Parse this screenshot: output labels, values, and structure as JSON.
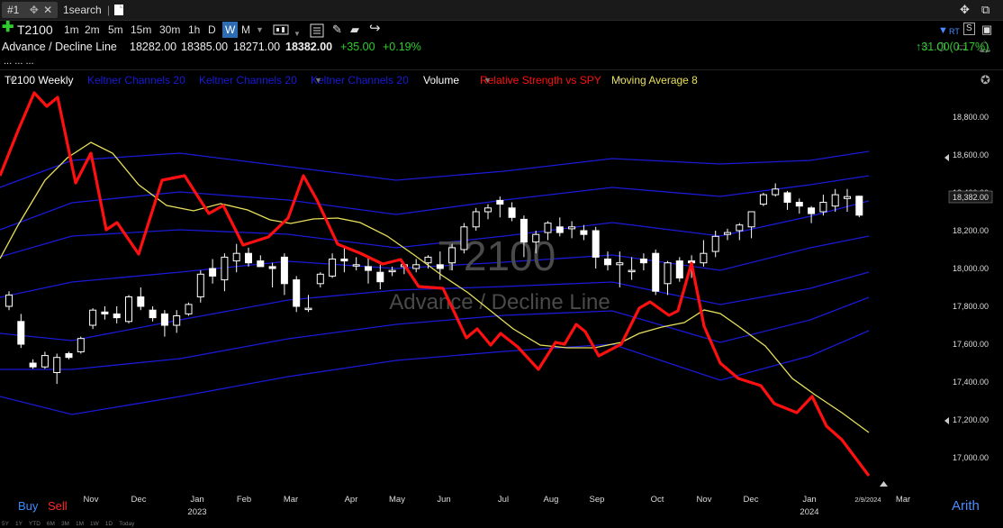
{
  "tabs": [
    {
      "label": "#1",
      "active": true
    },
    {
      "label": "1search",
      "active": false
    }
  ],
  "toolbar": {
    "symbol": "T2100",
    "timeframes": [
      "1m",
      "2m",
      "5m",
      "15m",
      "30m",
      "1h",
      "D",
      "W",
      "M"
    ],
    "active_timeframe": "W"
  },
  "quote": {
    "name": "Advance / Decline Line",
    "open": "18282.00",
    "high": "18385.00",
    "low": "18271.00",
    "close": "18382.00",
    "change": "+35.00",
    "change_pct": "+0.19%",
    "ellipsis": "... ...  ...",
    "right_change": "31.00(0.17%)"
  },
  "plots": {
    "main": "T2100 Weekly",
    "kc1": "Keltner Channels 20",
    "kc2": "Keltner Channels 20",
    "kc3": "Keltner Channels 20",
    "volume": "Volume",
    "rs": "Relative Strength vs SPY",
    "ma": "Moving Average 8"
  },
  "watermark": {
    "symbol": "T2100",
    "name": "Advance / Decline Line"
  },
  "colors": {
    "up": "#ffffff",
    "down": "#ffffff",
    "keltner": "#1a1ad6",
    "rs": "#ff1010",
    "ma": "#e8e05a",
    "change_up": "#2ecc2e"
  },
  "chart_data": {
    "type": "candlestick",
    "price_axis": [
      "18,800.00",
      "18,600.00",
      "18,400.00",
      "18,200.00",
      "18,000.00",
      "17,800.00",
      "17,600.00",
      "17,400.00",
      "17,200.00",
      "17,000.00"
    ],
    "current_price_label": "18,382.00",
    "x_labels": [
      "Nov",
      "Dec",
      "Jan",
      "Feb",
      "Mar",
      "Apr",
      "May",
      "Jun",
      "Jul",
      "Aug",
      "Sep",
      "Oct",
      "Nov",
      "Dec",
      "Jan",
      "2/9/2024",
      "Mar"
    ],
    "year_labels": [
      "2023",
      "2024"
    ],
    "candles": [
      [
        17800,
        17880,
        17780,
        17860
      ],
      [
        17720,
        17760,
        17580,
        17600
      ],
      [
        17500,
        17520,
        17470,
        17480
      ],
      [
        17480,
        17560,
        17470,
        17540
      ],
      [
        17450,
        17550,
        17390,
        17530
      ],
      [
        17550,
        17560,
        17520,
        17530
      ],
      [
        17560,
        17640,
        17550,
        17630
      ],
      [
        17700,
        17790,
        17680,
        17780
      ],
      [
        17770,
        17800,
        17730,
        17760
      ],
      [
        17760,
        17800,
        17710,
        17740
      ],
      [
        17720,
        17860,
        17710,
        17850
      ],
      [
        17850,
        17900,
        17780,
        17800
      ],
      [
        17780,
        17800,
        17720,
        17740
      ],
      [
        17760,
        17780,
        17640,
        17700
      ],
      [
        17700,
        17780,
        17660,
        17750
      ],
      [
        17760,
        17820,
        17750,
        17810
      ],
      [
        17850,
        17990,
        17820,
        17970
      ],
      [
        18000,
        18050,
        17920,
        17960
      ],
      [
        17940,
        18080,
        17880,
        18060
      ],
      [
        18040,
        18130,
        17980,
        18080
      ],
      [
        18080,
        18110,
        18010,
        18030
      ],
      [
        18040,
        18070,
        18010,
        18010
      ],
      [
        18010,
        18030,
        17900,
        18000
      ],
      [
        18060,
        18080,
        17860,
        17920
      ],
      [
        17940,
        17960,
        17770,
        17800
      ],
      [
        17790,
        17860,
        17770,
        17790
      ],
      [
        17920,
        17980,
        17900,
        17970
      ],
      [
        17960,
        18080,
        17950,
        18050
      ],
      [
        18050,
        18110,
        17980,
        18040
      ],
      [
        18020,
        18060,
        17990,
        18020
      ],
      [
        18010,
        18060,
        17920,
        17990
      ],
      [
        17980,
        18020,
        17890,
        17930
      ],
      [
        17990,
        18010,
        17960,
        17990
      ],
      [
        18010,
        18030,
        17970,
        18020
      ],
      [
        18000,
        18050,
        17980,
        18020
      ],
      [
        18030,
        18070,
        18000,
        18060
      ],
      [
        18020,
        18090,
        17940,
        18000
      ],
      [
        18030,
        18130,
        17990,
        18110
      ],
      [
        18100,
        18240,
        18080,
        18220
      ],
      [
        18220,
        18320,
        18200,
        18300
      ],
      [
        18300,
        18340,
        18260,
        18320
      ],
      [
        18360,
        18380,
        18270,
        18340
      ],
      [
        18320,
        18350,
        18250,
        18270
      ],
      [
        18260,
        18280,
        18060,
        18140
      ],
      [
        18140,
        18200,
        18080,
        18180
      ],
      [
        18190,
        18250,
        18150,
        18240
      ],
      [
        18220,
        18270,
        18170,
        18190
      ],
      [
        18210,
        18250,
        18160,
        18220
      ],
      [
        18200,
        18230,
        18150,
        18180
      ],
      [
        18200,
        18220,
        18000,
        18060
      ],
      [
        18050,
        18090,
        17990,
        18020
      ],
      [
        18020,
        18090,
        17900,
        18030
      ],
      [
        17990,
        18060,
        17940,
        17990
      ],
      [
        18050,
        18080,
        17990,
        18030
      ],
      [
        18080,
        18100,
        17860,
        17880
      ],
      [
        17920,
        18040,
        17860,
        18030
      ],
      [
        18040,
        18060,
        17930,
        17950
      ],
      [
        18040,
        18070,
        17950,
        18030
      ],
      [
        18030,
        18150,
        18010,
        18080
      ],
      [
        18090,
        18200,
        18060,
        18170
      ],
      [
        18180,
        18210,
        18150,
        18190
      ],
      [
        18200,
        18240,
        18150,
        18230
      ],
      [
        18220,
        18300,
        18160,
        18300
      ],
      [
        18340,
        18400,
        18330,
        18390
      ],
      [
        18390,
        18450,
        18380,
        18420
      ],
      [
        18400,
        18410,
        18310,
        18350
      ],
      [
        18350,
        18370,
        18290,
        18330
      ],
      [
        18320,
        18330,
        18240,
        18290
      ],
      [
        18300,
        18390,
        18280,
        18350
      ],
      [
        18330,
        18420,
        18300,
        18390
      ],
      [
        18370,
        18420,
        18300,
        18380
      ],
      [
        18382,
        18385,
        18271,
        18282
      ]
    ],
    "ma8_label": "Moving Average 8",
    "rs_label": "Relative Strength vs SPY"
  },
  "bottom": {
    "buy": "Buy",
    "sell": "Sell",
    "ranges": [
      "5Y",
      "1Y",
      "YTD",
      "6M",
      "3M",
      "1M",
      "1W",
      "1D",
      "Today"
    ],
    "scale": "Arith"
  }
}
